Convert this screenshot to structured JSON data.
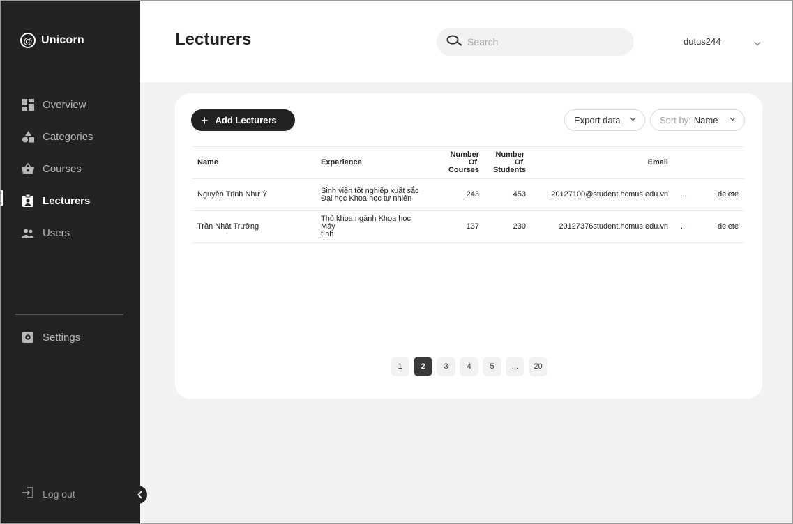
{
  "brand": {
    "logo_symbol": "@",
    "name": "Unicorn"
  },
  "sidebar": {
    "items": [
      {
        "label": "Overview",
        "icon": "dashboard-icon",
        "active": false
      },
      {
        "label": "Categories",
        "icon": "shapes-icon",
        "active": false
      },
      {
        "label": "Courses",
        "icon": "basket-icon",
        "active": false
      },
      {
        "label": "Lecturers",
        "icon": "clipboard-user-icon",
        "active": true
      },
      {
        "label": "Users",
        "icon": "users-icon",
        "active": false
      }
    ],
    "settings_label": "Settings",
    "logout_label": "Log out"
  },
  "header": {
    "title": "Lecturers",
    "search_placeholder": "Search",
    "username": "dutus244"
  },
  "toolbar": {
    "add_label": "Add Lecturers",
    "export_label": "Export data",
    "sort_prefix": "Sort by:",
    "sort_value": "Name"
  },
  "table": {
    "headers": {
      "name": "Name",
      "experience": "Experience",
      "courses": [
        "Number",
        "Of",
        "Courses"
      ],
      "students": [
        "Number",
        "Of",
        "Students"
      ],
      "email": "Email"
    },
    "rows": [
      {
        "name": "Nguyễn Trịnh Như Ý",
        "experience": [
          "Sinh viên tốt nghiệp xuất sắc",
          "Đại học Khoa học tự nhiên"
        ],
        "courses": "243",
        "students": "453",
        "email": "20127100@student.hcmus.edu.vn",
        "more": "...",
        "action": "delete"
      },
      {
        "name": "Trần Nhật Trường",
        "experience": [
          "Thủ khoa ngành Khoa học Máy",
          "tính"
        ],
        "courses": "137",
        "students": "230",
        "email": "20127376student.hcmus.edu.vn",
        "more": "...",
        "action": "delete"
      }
    ]
  },
  "pagination": {
    "pages": [
      "1",
      "2",
      "3",
      "4",
      "5",
      "...",
      "20"
    ],
    "current": "2"
  },
  "colors": {
    "sidebar_bg": "#232323",
    "page_bg": "#f2f2f2",
    "card_bg": "#ffffff",
    "accent_dark": "#232323"
  }
}
